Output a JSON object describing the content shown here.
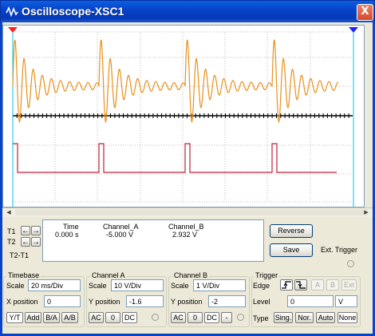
{
  "window": {
    "title": "Oscilloscope-XSC1",
    "close_glyph": "X",
    "icon": "oscilloscope-icon"
  },
  "readout": {
    "t1_label": "T1",
    "t2_label": "T2",
    "t2t1_label": "T2-T1",
    "headers": [
      "Time",
      "Channel_A",
      "Channel_B"
    ],
    "row": [
      "0.000 s",
      "-5.000 V",
      "2.932 V"
    ]
  },
  "buttons": {
    "reverse": "Reverse",
    "save": "Save",
    "ext_trigger": "Ext. Trigger"
  },
  "timebase": {
    "title": "Timebase",
    "scale_label": "Scale",
    "scale_value": "20 ms/Div",
    "xpos_label": "X position",
    "xpos_value": "0",
    "modes": [
      "Y/T",
      "Add",
      "B/A",
      "A/B"
    ]
  },
  "channel_a": {
    "title": "Channel A",
    "scale_label": "Scale",
    "scale_value": "10  V/Div",
    "ypos_label": "Y position",
    "ypos_value": "-1.6",
    "coupling": [
      "AC",
      "0",
      "DC"
    ]
  },
  "channel_b": {
    "title": "Channel B",
    "scale_label": "Scale",
    "scale_value": "1  V/Div",
    "ypos_label": "Y position",
    "ypos_value": "-2",
    "coupling": [
      "AC",
      "0",
      "DC",
      "-"
    ]
  },
  "trigger": {
    "title": "Trigger",
    "edge_label": "Edge",
    "edge_buttons": [
      "A",
      "B",
      "Ext"
    ],
    "level_label": "Level",
    "level_value": "0",
    "level_unit": "V",
    "type_label": "Type",
    "types": [
      "Sing.",
      "Nor.",
      "Auto",
      "None"
    ]
  },
  "colors": {
    "channel_a": "#e8911c",
    "channel_b": "#c0203a",
    "cursor1": "#ff2020",
    "cursor2": "#2020ff",
    "title_bar": "#0843c8"
  }
}
